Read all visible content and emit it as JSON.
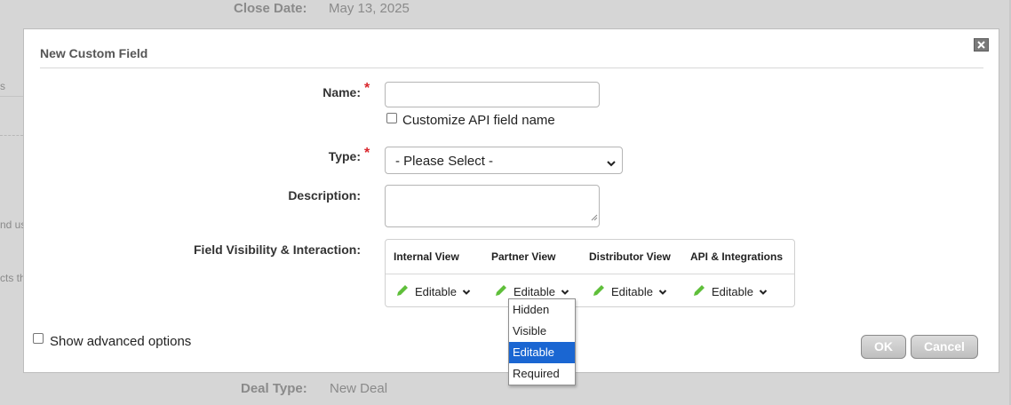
{
  "background": {
    "close_date_label": "Close Date:",
    "close_date_value": "May 13, 2025",
    "deal_type_label": "Deal Type:",
    "deal_type_value": "New Deal",
    "frag_s": "s",
    "frag_and_us": "nd us",
    "frag_cts_th": "cts th"
  },
  "dialog": {
    "title": "New Custom Field",
    "close_glyph": "close-icon",
    "name_label": "Name:",
    "name_value": "",
    "customize_api_label": "Customize API field name",
    "type_label": "Type:",
    "type_selected": "- Please Select -",
    "description_label": "Description:",
    "description_value": "",
    "visibility_label": "Field Visibility & Interaction:",
    "required_marker": "*",
    "visibility_columns": [
      {
        "header": "Internal View",
        "value": "Editable"
      },
      {
        "header": "Partner View",
        "value": "Editable"
      },
      {
        "header": "Distributor View",
        "value": "Editable"
      },
      {
        "header": "API & Integrations",
        "value": "Editable"
      }
    ],
    "dropdown_options": [
      "Hidden",
      "Visible",
      "Editable",
      "Required"
    ],
    "dropdown_selected": "Editable",
    "show_advanced_label": "Show advanced options",
    "ok_label": "OK",
    "cancel_label": "Cancel"
  },
  "colors": {
    "accent_pencil": "#5fbf3a",
    "required_star": "#d9262c",
    "selected_option": "#1a66d2"
  }
}
